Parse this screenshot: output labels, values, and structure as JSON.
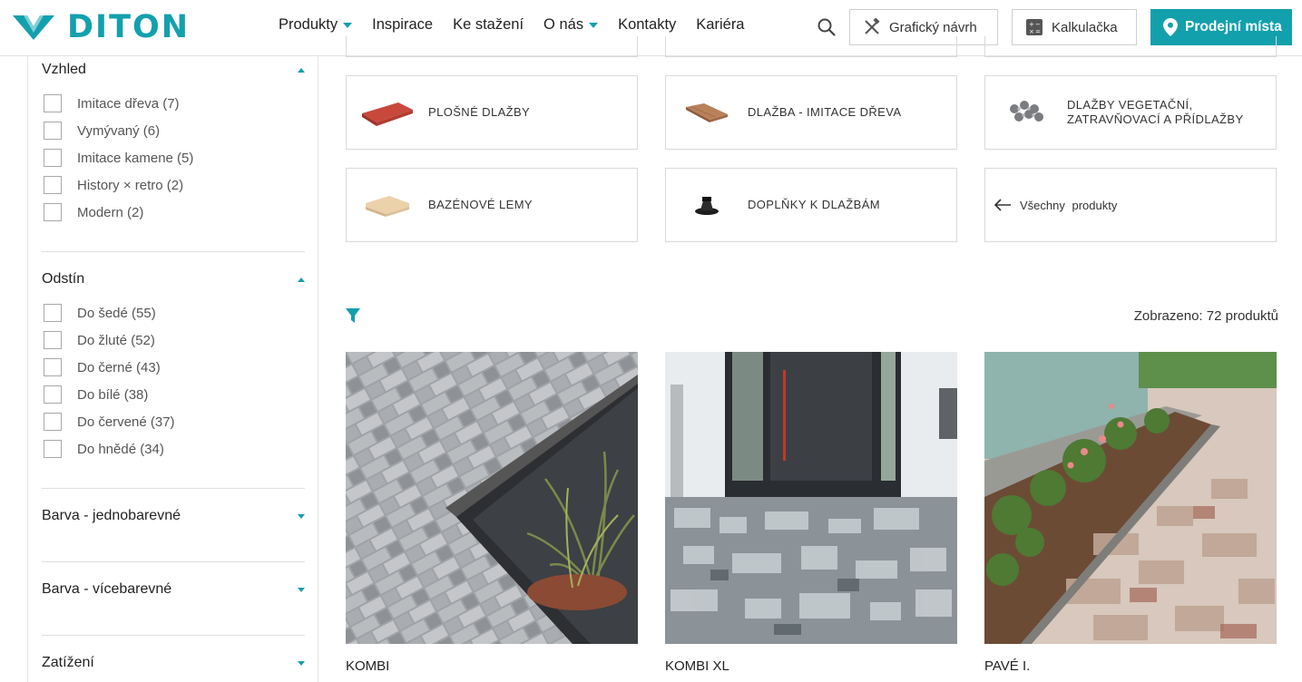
{
  "brand": {
    "name": "DITON",
    "accent": "#13a0ad"
  },
  "nav": {
    "items": [
      {
        "label": "Produkty",
        "has_dropdown": true
      },
      {
        "label": "Inspirace",
        "has_dropdown": false
      },
      {
        "label": "Ke stažení",
        "has_dropdown": false
      },
      {
        "label": "O nás",
        "has_dropdown": true
      },
      {
        "label": "Kontakty",
        "has_dropdown": false
      },
      {
        "label": "Kariéra",
        "has_dropdown": false
      }
    ],
    "search_icon": "search-icon",
    "design_button": "Grafický návrh",
    "calculator_button": "Kalkulačka",
    "stores_button": "Prodejní místa"
  },
  "filters": {
    "appearance": {
      "title": "Vzhled",
      "expanded": true,
      "options": [
        "Imitace dřeva (7)",
        "Vymývaný (6)",
        "Imitace kamene (5)",
        "History × retro (2)",
        "Modern (2)"
      ]
    },
    "shade": {
      "title": "Odstín",
      "expanded": true,
      "options": [
        "Do šedé (55)",
        "Do žluté (52)",
        "Do černé (43)",
        "Do bílé (38)",
        "Do červené (37)",
        "Do hnědé (34)"
      ]
    },
    "color_single": {
      "title": "Barva - jednobarevné",
      "expanded": false
    },
    "color_multi": {
      "title": "Barva - vícebarevné",
      "expanded": false
    },
    "load": {
      "title": "Zatížení",
      "expanded": false
    }
  },
  "categories": [
    {
      "label": "Plošné dlažby",
      "icon": "flat-tile-icon"
    },
    {
      "label": "Dlažba - imitace dřeva",
      "icon": "wood-tile-icon"
    },
    {
      "label": "Dlažby vegetační, zatravňovací a přídlažby",
      "icon": "grass-paver-icon"
    },
    {
      "label": "Bazénové lemy",
      "icon": "pool-edge-icon"
    },
    {
      "label": "Doplňky k dlažbám",
      "icon": "pedestal-icon"
    },
    {
      "label": "Všechny produkty",
      "icon": "arrow-left-icon"
    }
  ],
  "listing": {
    "count_text": "Zobrazeno: 72 produktů"
  },
  "products": [
    {
      "name": "KOMBI"
    },
    {
      "name": "KOMBI XL"
    },
    {
      "name": "PAVÉ I."
    }
  ]
}
